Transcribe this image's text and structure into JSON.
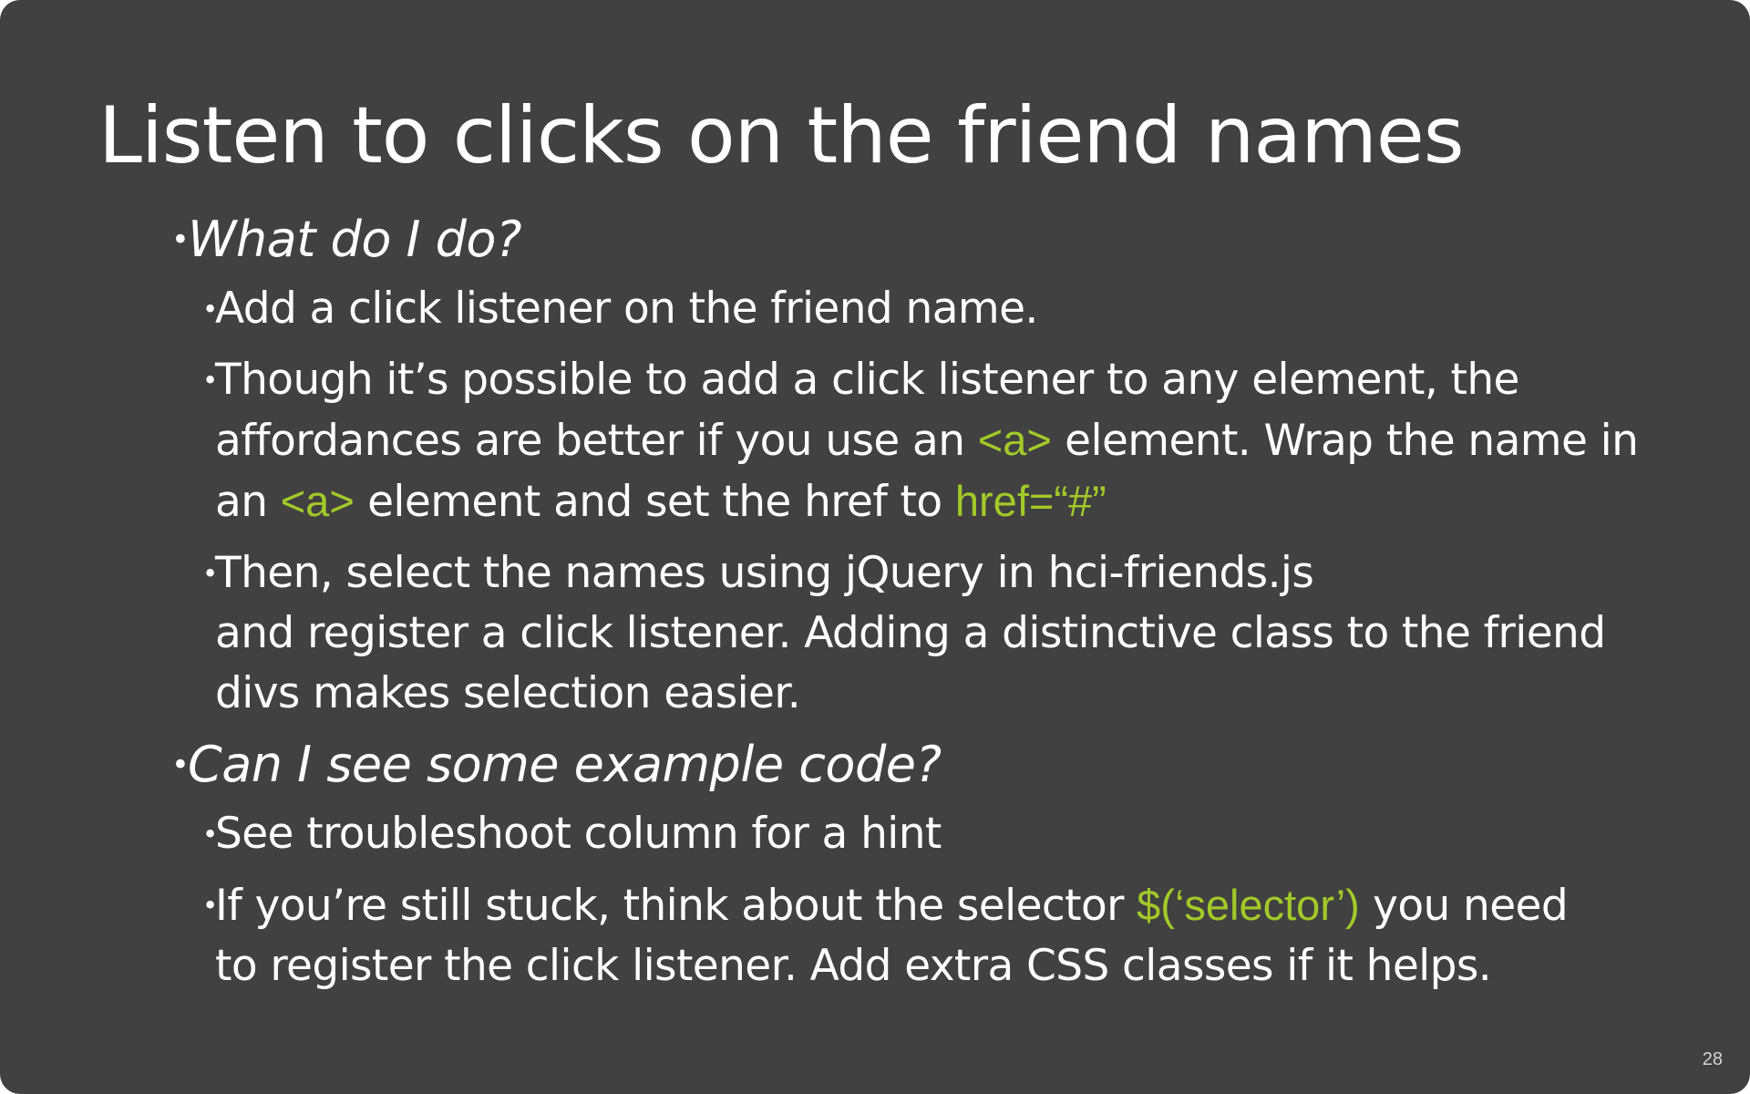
{
  "slide": {
    "title": "Listen to clicks on the friend names",
    "page_number": "28",
    "accent_color": "#a3c928",
    "background_color": "#414141",
    "section1": {
      "heading": "What do I do?",
      "item1": "Add a click listener on the friend name.",
      "item2": {
        "text_a": "Though it’s possible to add a click listener to any element, the",
        "text_b": "affordances are better if you use an ",
        "code_a": "<a>",
        "text_c": " element. Wrap the name in",
        "text_d": "an ",
        "code_b": "<a>",
        "text_e": " element and set the href to ",
        "code_c": "href=“#”"
      },
      "item3": {
        "line1": "Then, select the names using jQuery in hci-friends.js",
        "line2": "and register a click listener. Adding a distinctive class to the friend",
        "line3": "divs makes selection easier."
      }
    },
    "section2": {
      "heading": "Can I see some example code?",
      "item1": "See troubleshoot column for a hint",
      "item2": {
        "text_a": "If you’re still stuck, think about the selector ",
        "code_a": "$(‘selector’)",
        "text_b": " you need",
        "text_c": "to register the click listener. Add extra CSS classes if it helps."
      }
    }
  }
}
